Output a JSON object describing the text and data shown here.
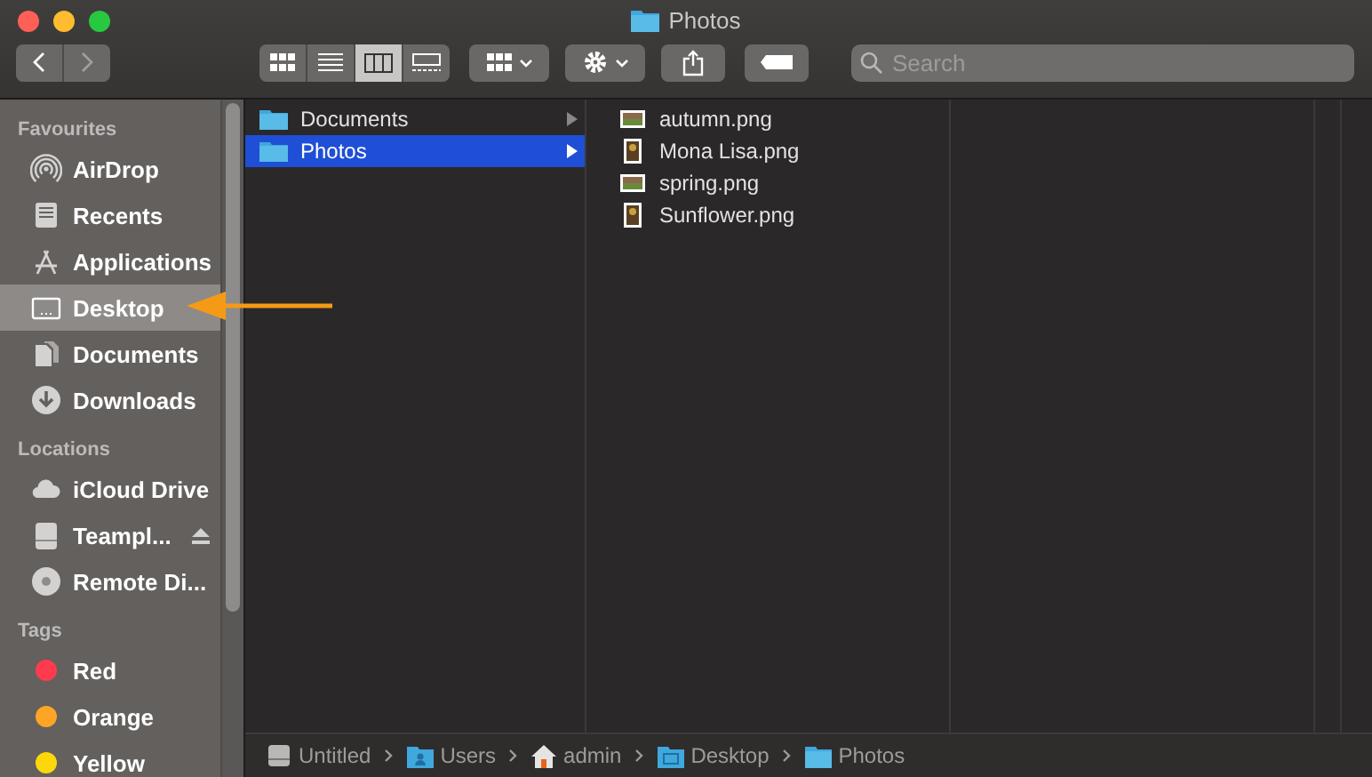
{
  "window": {
    "title": "Photos"
  },
  "toolbar": {
    "view_modes": [
      {
        "kind": "icons",
        "selected": false
      },
      {
        "kind": "list",
        "selected": false
      },
      {
        "kind": "columns",
        "selected": true
      },
      {
        "kind": "gallery",
        "selected": false
      }
    ],
    "search": {
      "placeholder": "Search"
    }
  },
  "sidebar": {
    "sections": [
      {
        "title": "Favourites",
        "items": [
          {
            "label": "AirDrop",
            "kind": "airdrop",
            "selected": false
          },
          {
            "label": "Recents",
            "kind": "recents",
            "selected": false
          },
          {
            "label": "Applications",
            "kind": "applications",
            "selected": false
          },
          {
            "label": "Desktop",
            "kind": "desktop",
            "selected": true
          },
          {
            "label": "Documents",
            "kind": "documents",
            "selected": false
          },
          {
            "label": "Downloads",
            "kind": "downloads",
            "selected": false
          }
        ]
      },
      {
        "title": "Locations",
        "items": [
          {
            "label": "iCloud Drive",
            "kind": "cloud",
            "selected": false
          },
          {
            "label": "Teampl...",
            "kind": "disk",
            "selected": false,
            "ejectable": true
          },
          {
            "label": "Remote Di...",
            "kind": "disc",
            "selected": false
          }
        ]
      },
      {
        "title": "Tags",
        "items": [
          {
            "label": "Red",
            "kind": "tag",
            "color": "#fe3b4d",
            "selected": false
          },
          {
            "label": "Orange",
            "kind": "tag",
            "color": "#fea525",
            "selected": false
          },
          {
            "label": "Yellow",
            "kind": "tag",
            "color": "#fed70b",
            "selected": false
          }
        ]
      }
    ]
  },
  "columns": [
    {
      "items": [
        {
          "label": "Documents",
          "kind": "folder",
          "selected": false,
          "has_children": true
        },
        {
          "label": "Photos",
          "kind": "folder",
          "selected": true,
          "has_children": true
        }
      ]
    },
    {
      "items": [
        {
          "label": "autumn.png",
          "kind": "landscape",
          "selected": false
        },
        {
          "label": "Mona Lisa.png",
          "kind": "portrait",
          "selected": false
        },
        {
          "label": "spring.png",
          "kind": "landscape",
          "selected": false
        },
        {
          "label": "Sunflower.png",
          "kind": "portrait",
          "selected": false
        }
      ]
    }
  ],
  "path_bar": [
    {
      "label": "Untitled",
      "kind": "disk"
    },
    {
      "label": "Users",
      "kind": "users"
    },
    {
      "label": "admin",
      "kind": "home"
    },
    {
      "label": "Desktop",
      "kind": "desktop"
    },
    {
      "label": "Photos",
      "kind": "folder"
    }
  ]
}
